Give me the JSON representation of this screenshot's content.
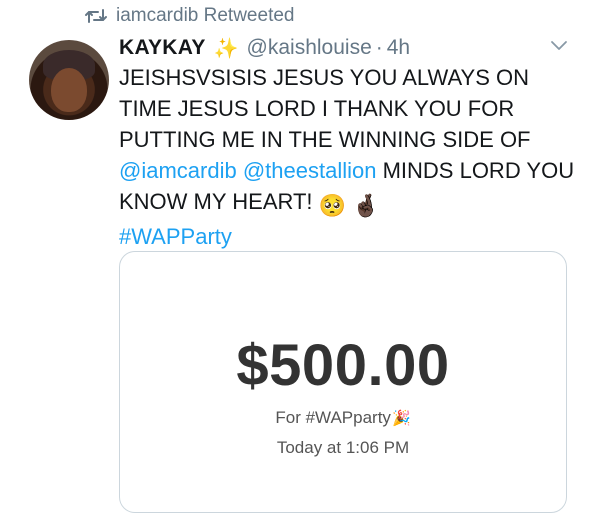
{
  "retweet": {
    "label": "iamcardib Retweeted",
    "icon": "retweet-icon"
  },
  "tweet": {
    "author_name": "KAYKAY",
    "author_emoji": "✨",
    "handle": "@kaishlouise",
    "separator": "·",
    "time": "4h",
    "text_part1": "JEISHSVSISIS JESUS YOU ALWAYS ON TIME JESUS LORD I THANK YOU FOR PUTTING ME IN THE WINNING SIDE OF ",
    "mention1": "@iamcardib",
    "space": " ",
    "mention2": "@theestallion",
    "text_part2": " MINDS LORD YOU KNOW MY HEART!",
    "emoji1": "🥺",
    "emoji2": "🤞🏿",
    "hashtag": "#WAPParty"
  },
  "card": {
    "amount": "$500.00",
    "memo": "For #WAPparty",
    "memo_emoji": "🎉",
    "date": "Today at 1:06 PM"
  },
  "colors": {
    "link": "#1da1f2",
    "muted": "#657786",
    "text": "#14171a",
    "card_border": "#ccd6dd"
  }
}
